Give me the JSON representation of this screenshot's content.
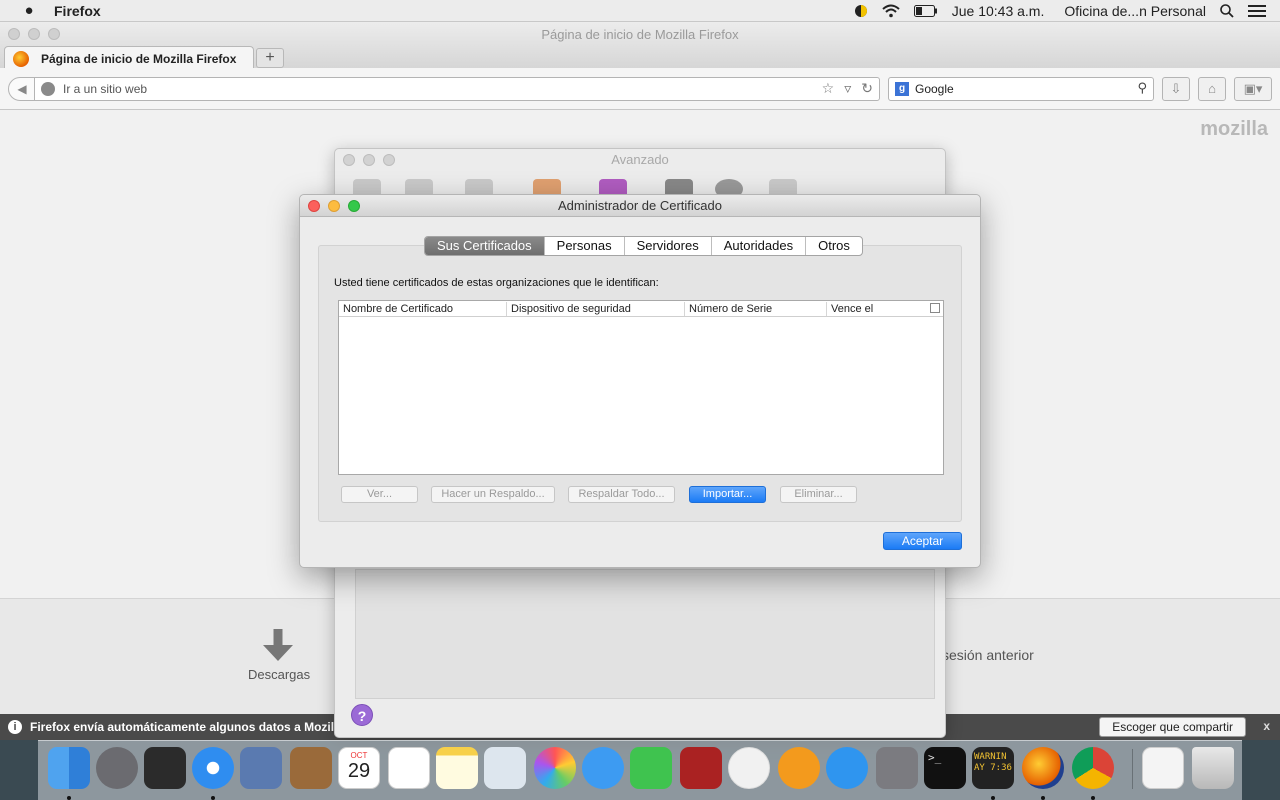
{
  "menubar": {
    "app_name": "Firefox",
    "clock": "Jue 10:43 a.m.",
    "user": "Oficina de...n Personal"
  },
  "browser": {
    "window_title": "Página de inicio de Mozilla Firefox",
    "tab_label": "Página de inicio de Mozilla Firefox",
    "new_tab": "+",
    "url_placeholder": "Ir a un sitio web",
    "search_engine": "Google",
    "brand": "mozilla",
    "downloads_label": "Descargas",
    "restore_session": "sesión anterior"
  },
  "notification": {
    "text": "Firefox envía automáticamente algunos datos a Mozilla pa",
    "button": "Escoger que compartir",
    "close": "x"
  },
  "prefs": {
    "title": "Avanzado",
    "help": "?"
  },
  "dialog": {
    "title": "Administrador de Certificado",
    "tabs": [
      "Sus Certificados",
      "Personas",
      "Servidores",
      "Autoridades",
      "Otros"
    ],
    "active_tab": "Sus Certificados",
    "intro": "Usted tiene certificados de estas organizaciones que le identifican:",
    "columns": [
      "Nombre de Certificado",
      "Dispositivo de seguridad",
      "Número de Serie",
      "Vence el"
    ],
    "buttons": {
      "view": "Ver...",
      "backup": "Hacer un Respaldo...",
      "backup_all": "Respaldar Todo...",
      "import": "Importar...",
      "delete": "Eliminar..."
    },
    "ok": "Aceptar"
  },
  "dock": {
    "calendar_month": "OCT",
    "calendar_day": "29",
    "console_text": "WARNIN AY 7:36"
  }
}
